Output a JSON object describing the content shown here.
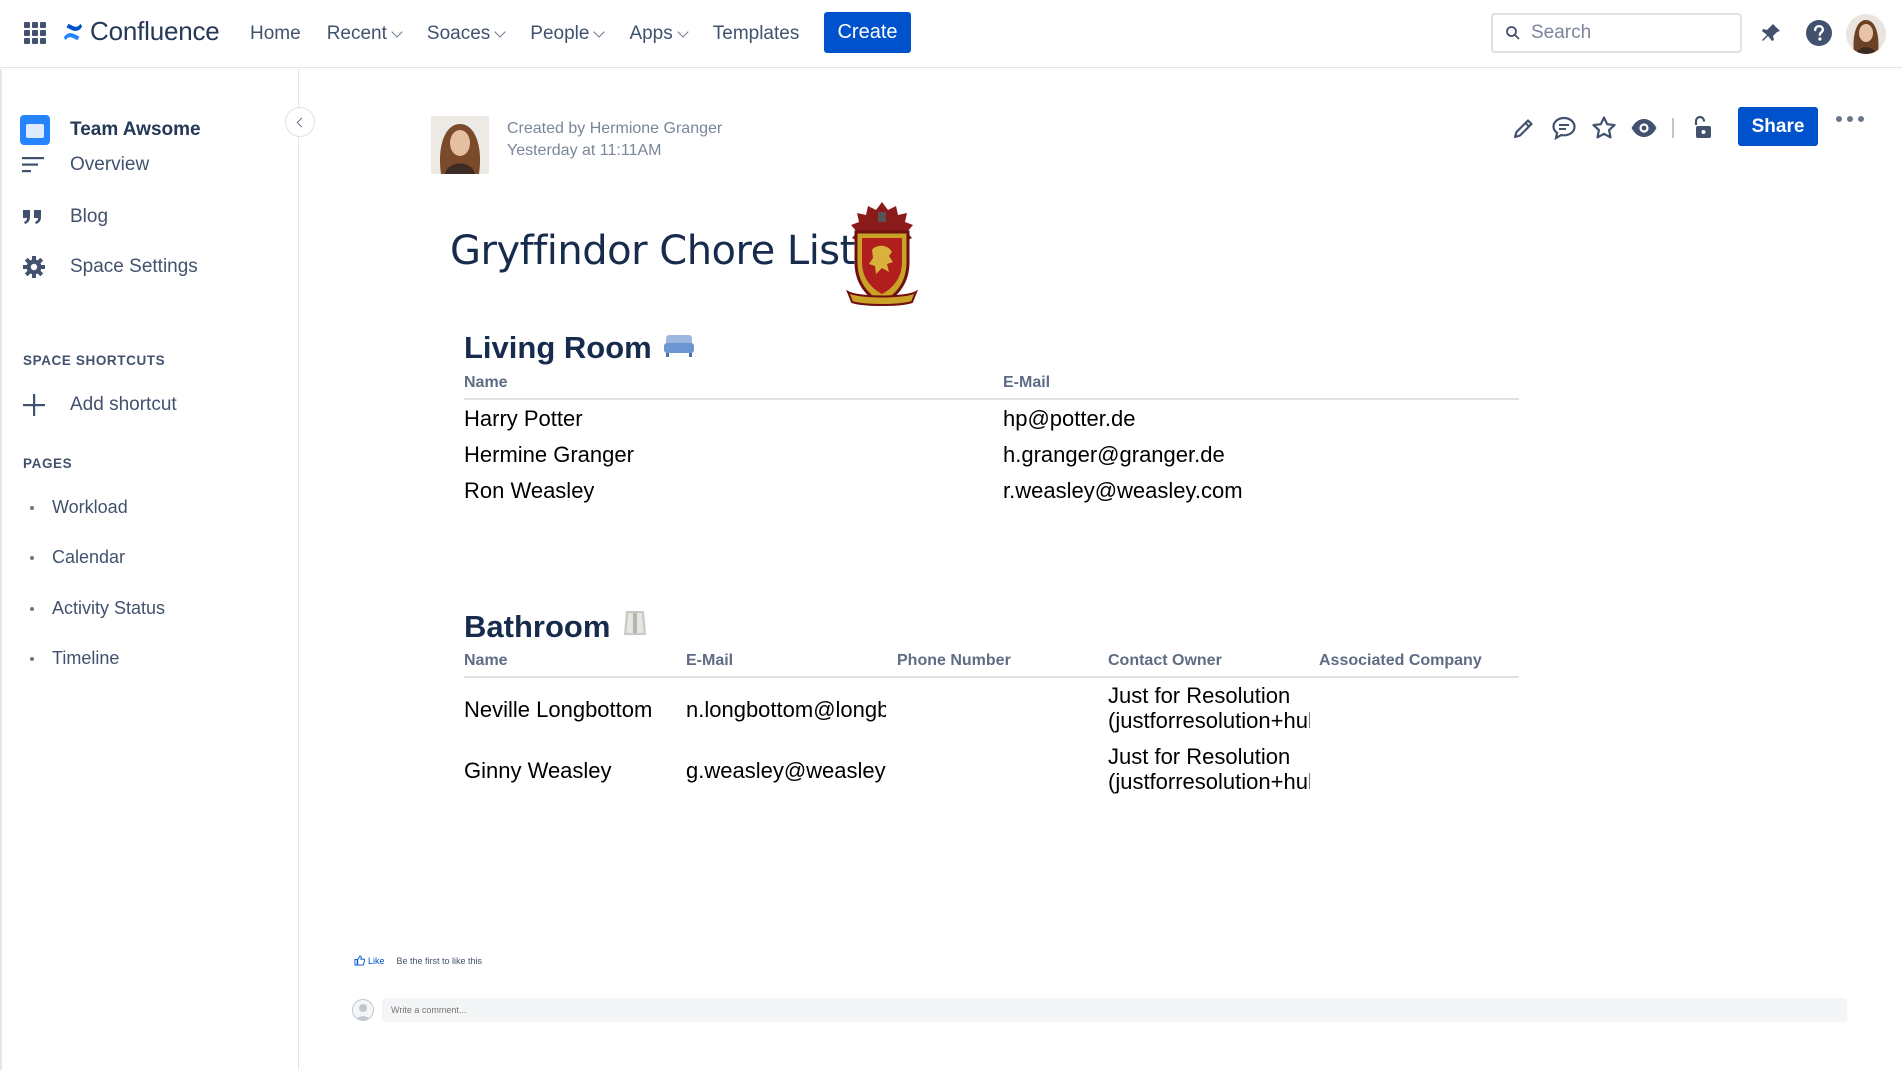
{
  "topbar": {
    "app_name": "Confluence",
    "nav": [
      {
        "label": "Home",
        "dropdown": false
      },
      {
        "label": "Recent",
        "dropdown": true
      },
      {
        "label": "Soaces",
        "dropdown": true
      },
      {
        "label": "People",
        "dropdown": true
      },
      {
        "label": "Apps",
        "dropdown": true
      },
      {
        "label": "Templates",
        "dropdown": false
      }
    ],
    "create_label": "Create",
    "search_placeholder": "Search",
    "icons": [
      "app-switcher-icon",
      "search-icon",
      "notifications-icon",
      "help-icon"
    ],
    "accent": "#0052CC"
  },
  "sidebar": {
    "space_name": "Team Awsome",
    "links": [
      {
        "label": "Overview",
        "icon": "overview-icon"
      },
      {
        "label": "Blog",
        "icon": "quote-icon"
      },
      {
        "label": "Space Settings",
        "icon": "gear-icon"
      }
    ],
    "shortcuts_heading": "SPACE SHORTCUTS",
    "add_shortcut": "Add shortcut",
    "pages_heading": "PAGES",
    "pages": [
      "Workload",
      "Calendar",
      "Activity Status",
      "Timeline"
    ]
  },
  "page": {
    "created_by": "Created by Hermione Granger",
    "created_at": "Yesterday at 11:11AM",
    "share_label": "Share",
    "title": "Gryffindor Chore List",
    "action_icons": [
      "edit-icon",
      "comment-icon",
      "star-icon",
      "watch-icon",
      "restrictions-icon",
      "more-icon"
    ]
  },
  "living_room": {
    "heading": "Living Room",
    "icon": "couch-icon",
    "columns": [
      "Name",
      "E-Mail"
    ],
    "rows": [
      [
        "Harry Potter",
        "hp@potter.de"
      ],
      [
        "Hermine Granger",
        "h.granger@granger.de"
      ],
      [
        "Ron Weasley",
        "r.weasley@weasley.com"
      ]
    ]
  },
  "bathroom": {
    "heading": "Bathroom",
    "icon": "toilet-paper-icon",
    "columns": [
      "Name",
      "E-Mail",
      "Phone Number",
      "Contact Owner",
      "Associated Company"
    ],
    "rows": [
      {
        "name": "Neville Longbottom",
        "email": "n.longbottom@longbottom",
        "phone": "",
        "owner_line1": "Just for Resolution",
        "owner_line2": "(justforresolution+hubspot",
        "company": ""
      },
      {
        "name": "Ginny Weasley",
        "email": "g.weasley@weasley.com",
        "phone": "",
        "owner_line1": "Just for Resolution",
        "owner_line2": "(justforresolution+hubspot",
        "company": ""
      }
    ]
  },
  "footer": {
    "like_label": "Like",
    "like_note": "Be the first to like this",
    "comment_placeholder": "Write a comment..."
  }
}
